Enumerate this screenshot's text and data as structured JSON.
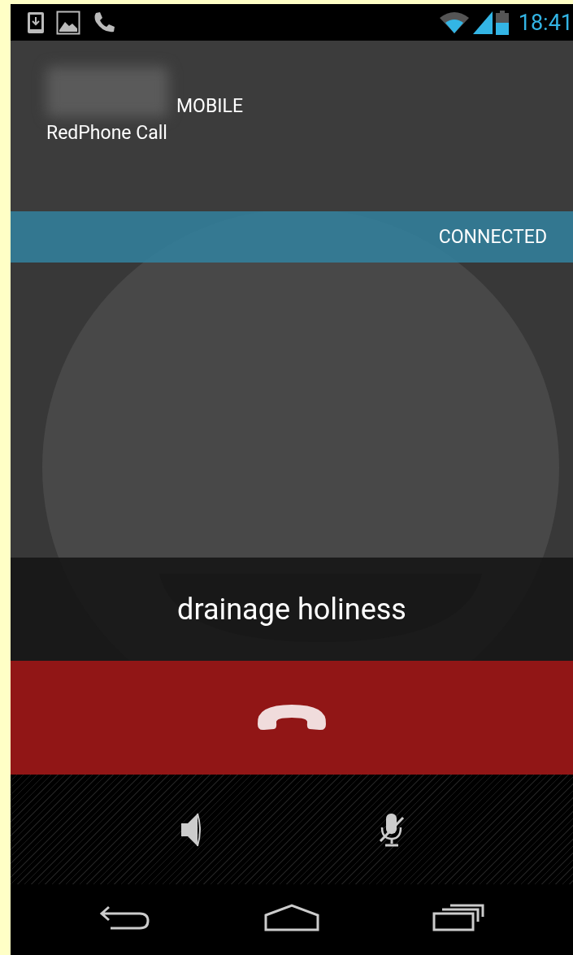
{
  "status_bar": {
    "notifications": [
      {
        "kind": "download"
      },
      {
        "kind": "image"
      },
      {
        "kind": "phone"
      }
    ],
    "time": "18:41"
  },
  "caller": {
    "number_type": "MOBILE",
    "call_type": "RedPhone Call"
  },
  "call_state": "CONNECTED",
  "sas_phrase": "drainage holiness",
  "controls": [
    {
      "kind": "speaker",
      "on": false
    },
    {
      "kind": "mic",
      "muted": true
    }
  ],
  "nav_bar": [
    {
      "kind": "back"
    },
    {
      "kind": "home"
    },
    {
      "kind": "recents"
    }
  ]
}
